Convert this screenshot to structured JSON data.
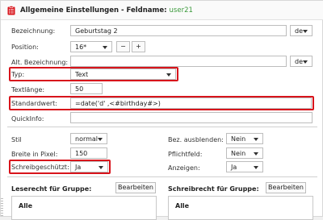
{
  "header": {
    "title": "Allgemeine Einstellungen - Feldname:",
    "field_name": "user21",
    "icon": "clipboard-list-icon",
    "accent": "#d8141b",
    "field_color": "#3c9a3c"
  },
  "form": {
    "bezeichnung": {
      "label": "Bezeichnung:",
      "value": "Geburtstag 2",
      "lang": "de"
    },
    "position": {
      "label": "Position:",
      "value": "16*",
      "minus": "−",
      "plus": "+"
    },
    "alt_bezeichnung": {
      "label": "Alt. Bezeichnung:",
      "value": "",
      "lang": "de"
    },
    "typ": {
      "label": "Typ:",
      "value": "Text"
    },
    "textlaenge": {
      "label": "Textlänge:",
      "value": "50"
    },
    "standardwert": {
      "label": "Standardwert:",
      "value": "=date('d' ,<#birthday#>)"
    },
    "quickinfo": {
      "label": "QuickInfo:",
      "value": ""
    }
  },
  "options": {
    "stil": {
      "label": "Stil",
      "value": "normal"
    },
    "breite": {
      "label": "Breite in Pixel:",
      "value": "150"
    },
    "schreibgeschuetzt": {
      "label": "Schreibgeschützt:",
      "value": "Ja"
    },
    "bez_ausblenden": {
      "label": "Bez. ausblenden:",
      "value": "Nein"
    },
    "pflichtfeld": {
      "label": "Pflichtfeld:",
      "value": "Nein"
    },
    "anzeigen": {
      "label": "Anzeigen:",
      "value": "Ja"
    }
  },
  "permissions": {
    "leserecht": {
      "label": "Leserecht für Gruppe:",
      "button": "Bearbeiten",
      "value": "Alle"
    },
    "schreibrecht": {
      "label": "Schreibrecht für Gruppe:",
      "button": "Bearbeiten",
      "value": "Alle"
    }
  }
}
